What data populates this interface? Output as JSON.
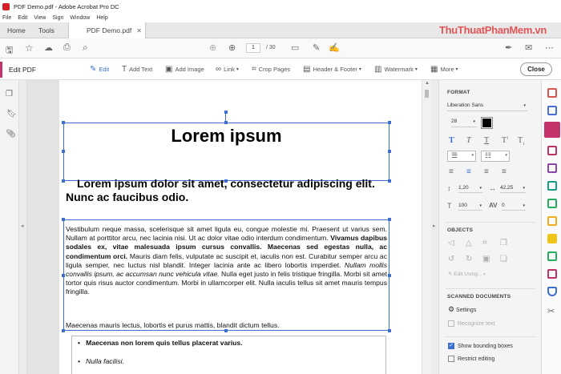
{
  "window": {
    "title": "PDF Demo.pdf - Adobe Acrobat Pro DC"
  },
  "menu": [
    "File",
    "Edit",
    "View",
    "Sign",
    "Window",
    "Help"
  ],
  "tabs": {
    "home": "Home",
    "tools": "Tools",
    "doc": "PDF Demo.pdf"
  },
  "watermark": "ThuThuatPhanMem.vn",
  "toolbar": {
    "page_current": "1",
    "page_total": "/ 30"
  },
  "editbar": {
    "title": "Edit PDF",
    "edit": "Edit",
    "add_text": "Add Text",
    "add_image": "Add Image",
    "link": "Link",
    "crop": "Crop Pages",
    "header_footer": "Header & Footer",
    "watermark": "Watermark",
    "more": "More",
    "close": "Close"
  },
  "document": {
    "title": "Lorem ipsum",
    "subtitle": "Lorem ipsum dolor sit amet, consectetur adipiscing elit. Nunc ac faucibus odio.",
    "p1_a": "Vestibulum neque massa, scelerisque sit amet ligula eu, congue molestie mi. Praesent ut varius sem. Nullam at porttitor arcu, nec lacinia nisi. Ut ac dolor vitae odio interdum condimentum. ",
    "p1_b": "Vivamus dapibus sodales ex, vitae malesuada ipsum cursus convallis. Maecenas sed egestas nulla, ac condimentum orci.",
    "p1_c": " Mauris diam felis, vulputate ac suscipit et, iaculis non est. Curabitur semper arcu ac ligula semper, nec luctus nisl blandit. Integer lacinia ante ac libero lobortis imperdiet. ",
    "p1_d": "Nullam mollis convallis ipsum, ac accumsan nunc vehicula vitae.",
    "p1_e": " Nulla eget justo in felis tristique fringilla. Morbi sit amet tortor quis risus auctor condimentum. Morbi in ullamcorper elit. Nulla iaculis tellus sit amet mauris tempus fringilla.",
    "p2": "Maecenas mauris lectus, lobortis et purus mattis, blandit dictum tellus.",
    "bullet1": "Maecenas non lorem quis tellus placerat varius.",
    "bullet2": "Nulla facilisi."
  },
  "panel": {
    "format": "FORMAT",
    "font": "Liberation Sans",
    "size": "28",
    "line_spacing": "1,20",
    "char_spacing": "42,25",
    "scale": "100",
    "av": "0",
    "objects": "OBJECTS",
    "edit_using": "Edit Using...",
    "scanned": "SCANNED DOCUMENTS",
    "settings": "Settings",
    "recognize": "Recognize text",
    "show_bbox": "Show bounding boxes",
    "restrict": "Restrict editing"
  },
  "colors": {
    "accent": "#c4326a",
    "selection": "#3d6fd1",
    "text_color": "#000000"
  }
}
